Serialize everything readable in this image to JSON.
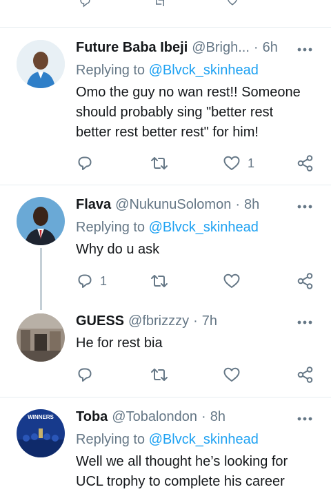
{
  "tweets": [
    {
      "name": "Future Baba Ibeji",
      "handle": "@Brigh...",
      "time": "6h",
      "reply_prefix": "Replying to",
      "reply_mention": "@Blvck_skinhead",
      "text_lines": [
        "Omo the guy no wan rest!! Someone",
        "should probably sing \"better rest",
        "better rest better rest\" for him!"
      ],
      "like_count": "1",
      "reply_count": "",
      "avatar_bg": "#dfe9ef"
    },
    {
      "name": "Flava",
      "handle": "@NukunuSolomon",
      "time": "8h",
      "reply_prefix": "Replying to",
      "reply_mention": "@Blvck_skinhead",
      "text_lines": [
        "Why do u ask"
      ],
      "reply_count": "1",
      "like_count": "",
      "avatar_bg": "#5a9fd0"
    },
    {
      "name": "GUESS",
      "handle": "@fbrizzzy",
      "time": "7h",
      "text_lines": [
        "He for rest bia"
      ],
      "reply_count": "",
      "like_count": "",
      "avatar_bg": "#8a7e72"
    },
    {
      "name": "Toba",
      "handle": "@Tobalondon",
      "time": "8h",
      "reply_prefix": "Replying to",
      "reply_mention": "@Blvck_skinhead",
      "text_lines": [
        "Well we all thought he’s looking for",
        "UCL trophy to complete his career"
      ],
      "avatar_badge": "WINNERS",
      "avatar_bg": "#1c3c8c"
    }
  ],
  "colors": {
    "link": "#1da1f2",
    "secondary": "#657786",
    "divider": "#e6ecf0",
    "icon": "#657786"
  }
}
